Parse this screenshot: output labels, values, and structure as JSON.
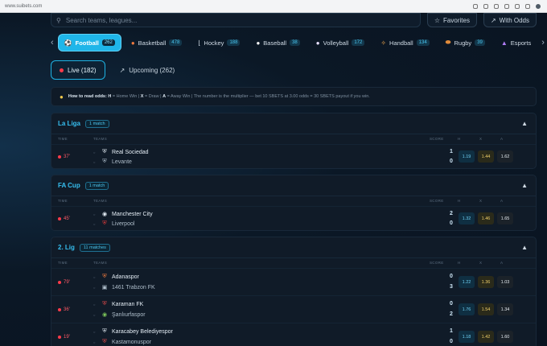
{
  "browser": {
    "url": "www.suibets.com"
  },
  "header": {
    "search_placeholder": "Search teams, leagues...",
    "favorites_label": "Favorites",
    "with_odds_label": "With Odds"
  },
  "sports": [
    {
      "name": "Football",
      "count": "262",
      "active": true,
      "icon": "football-icon"
    },
    {
      "name": "Basketball",
      "count": "478",
      "icon": "basketball-icon"
    },
    {
      "name": "Hockey",
      "count": "188",
      "icon": "hockey-icon"
    },
    {
      "name": "Baseball",
      "count": "38",
      "icon": "baseball-icon"
    },
    {
      "name": "Volleyball",
      "count": "172",
      "icon": "volleyball-icon"
    },
    {
      "name": "Handball",
      "count": "134",
      "icon": "handball-icon"
    },
    {
      "name": "Rugby",
      "count": "39",
      "icon": "rugby-icon"
    },
    {
      "name": "Esports",
      "count": "",
      "icon": "esports-icon"
    }
  ],
  "tabs": {
    "live": "Live (182)",
    "upcoming": "Upcoming (262)"
  },
  "hint": {
    "title": "How to read odds:",
    "h": "H",
    "h_text": "= Home Win",
    "x": "X",
    "x_text": "= Draw",
    "a": "A",
    "a_text": "= Away Win",
    "rest": "The number is the multiplier — bet 10 SBETS at 3.00 odds = 30 SBETS payout if you win."
  },
  "columns": {
    "time": "TIME",
    "teams": "TEAMS",
    "score": "SCORE",
    "h": "H",
    "x": "X",
    "a": "A"
  },
  "leagues": [
    {
      "name": "La Liga",
      "matches_label": "1 match",
      "matches": [
        {
          "time": "37'",
          "home": "Real Sociedad",
          "away": "Levante",
          "home_score": "1",
          "away_score": "0",
          "h": "1.19",
          "x": "1.44",
          "a": "1.62"
        }
      ]
    },
    {
      "name": "FA Cup",
      "matches_label": "1 match",
      "matches": [
        {
          "time": "45'",
          "home": "Manchester City",
          "away": "Liverpool",
          "home_score": "2",
          "away_score": "0",
          "h": "1.32",
          "x": "1.46",
          "a": "1.65"
        }
      ]
    },
    {
      "name": "2. Lig",
      "matches_label": "11 matches",
      "matches": [
        {
          "time": "79'",
          "home": "Adanaspor",
          "away": "1461 Trabzon FK",
          "home_score": "0",
          "away_score": "3",
          "h": "1.22",
          "x": "1.36",
          "a": "1.03"
        },
        {
          "time": "36'",
          "home": "Karaman FK",
          "away": "Şanlıurfaspor",
          "home_score": "0",
          "away_score": "2",
          "h": "1.76",
          "x": "1.54",
          "a": "1.34"
        },
        {
          "time": "19'",
          "home": "Karacabey Belediyespor",
          "away": "Kastamonuspor",
          "home_score": "1",
          "away_score": "0",
          "h": "1.18",
          "x": "1.42",
          "a": "1.60"
        }
      ]
    }
  ]
}
